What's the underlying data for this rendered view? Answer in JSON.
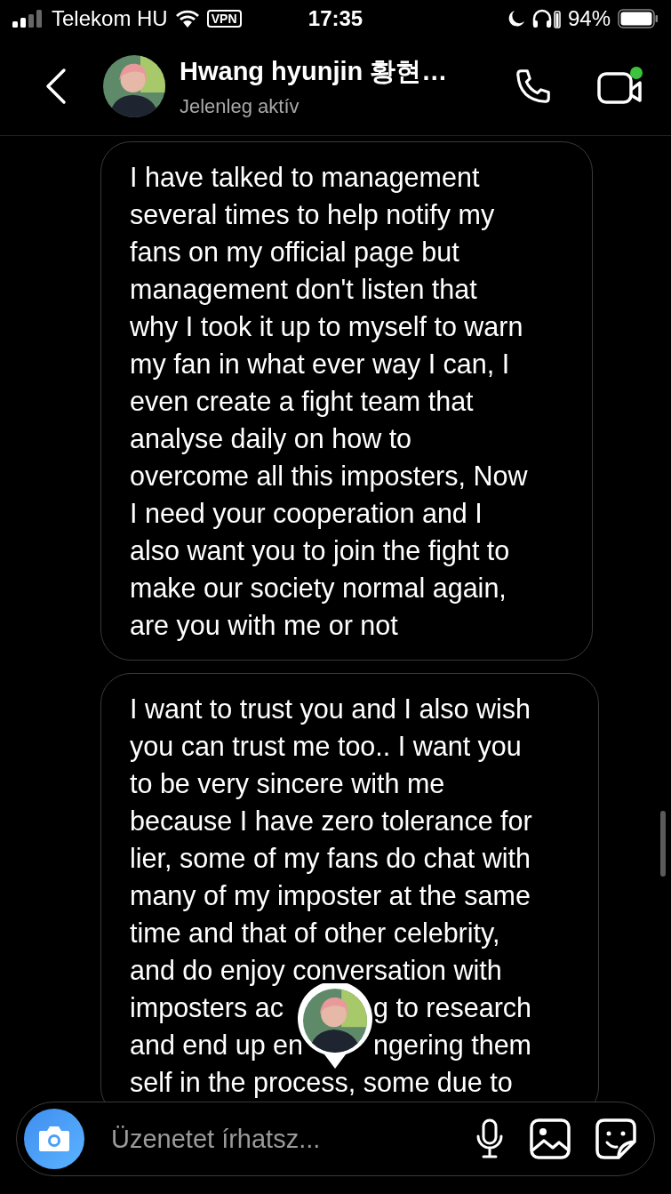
{
  "status_bar": {
    "carrier": "Telekom HU",
    "vpn": "VPN",
    "time": "17:35",
    "battery": "94%"
  },
  "header": {
    "name": "Hwang hyunjin 황현…",
    "status": "Jelenleg aktív",
    "video_active": true
  },
  "messages": [
    {
      "lines": [
        "I have talked to management",
        "several times to help notify my",
        "fans on my official page but",
        "management don't listen that",
        "why I took it up to myself to warn",
        "my fan in what ever way I can, I",
        "even create a fight team that",
        "analyse daily on how to",
        "overcome all this imposters, Now",
        "I need your cooperation and I",
        "also want you to join the fight to",
        "make our society normal again,",
        "are you with me or not"
      ]
    },
    {
      "lines": [
        "I want to trust you and I also wish",
        "you can trust me too.. I want you",
        "to be very sincere with me",
        "because I have zero tolerance for",
        "lier, some of my fans do chat with",
        "many of my imposter at the same",
        "time and that of other celebrity,",
        "and do enjoy conversation with",
        [
          "imposters ac",
          "g to research"
        ],
        [
          "and end up en",
          "ngering them"
        ],
        "self in the process, some due to"
      ]
    }
  ],
  "composer": {
    "placeholder": "Üzenetet írhatsz..."
  }
}
